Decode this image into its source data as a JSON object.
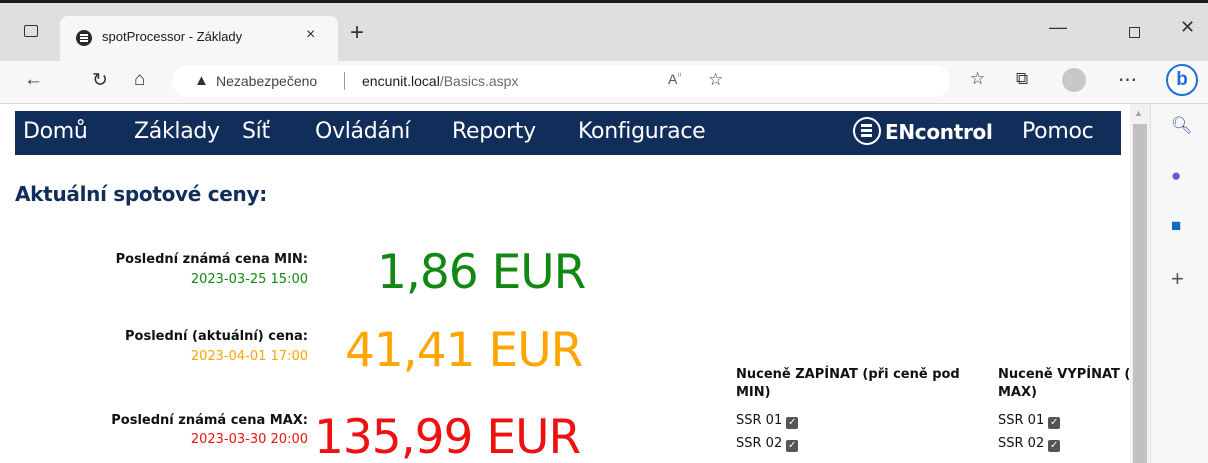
{
  "browser": {
    "tab_title": "spotProcessor - Základy",
    "tab_close": "×",
    "new_tab": "+",
    "window_min": "—",
    "window_close": "✕",
    "address_warning": "Nezabezpečeno",
    "address_host": "encunit.local",
    "address_path": "/Basics.aspx",
    "read_aloud": "A⁾",
    "icons": [
      "back-icon",
      "refresh-icon",
      "home-icon",
      "read-aloud-icon",
      "add-favorite-icon",
      "favorites-icon",
      "collections-icon",
      "profile-icon",
      "more-icon",
      "bing-icon"
    ]
  },
  "nav": {
    "items": [
      "Domů",
      "Základy",
      "Síť",
      "Ovládání",
      "Reporty",
      "Konfigurace"
    ],
    "brand": "ENcontrol",
    "help": "Pomoc"
  },
  "page": {
    "heading": "Aktuální spotové ceny:",
    "min": {
      "label": "Poslední známá cena MIN:",
      "date": "2023-03-25 15:00",
      "price": "1,86 EUR",
      "color": "#118811"
    },
    "current": {
      "label": "Poslední (aktuální) cena:",
      "date": "2023-04-01 17:00",
      "price": "41,41 EUR",
      "color": "#ffa500"
    },
    "max": {
      "label": "Poslední známá cena MAX:",
      "date": "2023-03-30 20:00",
      "price": "135,99 EUR",
      "color": "#ee1111"
    },
    "force_on": {
      "heading_line1": "Nuceně ZAPÍNAT (při ceně pod",
      "heading_line2": "MIN)",
      "items": [
        "SSR 01",
        "SSR 02"
      ]
    },
    "force_off": {
      "heading_line1": "Nuceně VYPÍNAT (při ceně n",
      "heading_line2": "MAX)",
      "items": [
        "SSR 01",
        "SSR 02"
      ]
    },
    "checkbox_mark": "✓"
  },
  "colors": {
    "nav_bg": "#112d5a",
    "heading": "#112d5a"
  }
}
